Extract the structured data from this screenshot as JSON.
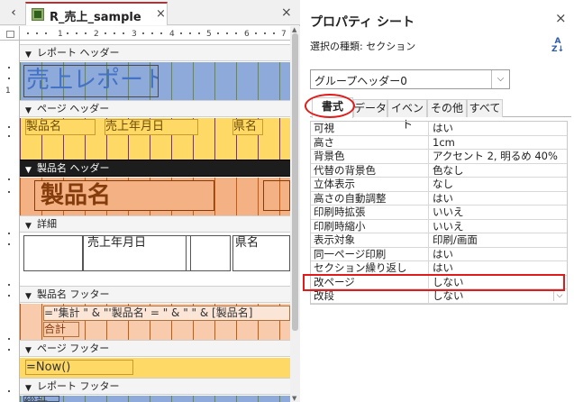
{
  "document_tab": {
    "title": "R_売上_sample",
    "close": "×"
  },
  "nav_prev": "‹",
  "window_close": "×",
  "ruler": {
    "marks": [
      "1",
      "2",
      "3",
      "4",
      "5",
      "6",
      "7"
    ],
    "vmarks": [
      "1"
    ]
  },
  "sections": {
    "report_header": "レポート ヘッダー",
    "page_header": "ページ ヘッダー",
    "group_header": "製品名 ヘッダー",
    "detail": "詳細",
    "group_footer": "製品名 フッター",
    "page_footer": "ページ フッター",
    "report_footer": "レポート フッター"
  },
  "controls": {
    "report_title": "売上レポート",
    "col_product": "製品名",
    "col_date": "売上年月日",
    "col_pref": "県名",
    "group_product": "製品名",
    "detail_date": "売上年月日",
    "detail_pref": "県名",
    "footer_expr": "=\"集計 \" & \"'製品名' = \" & \" \" & [製品名]",
    "footer_total": "合計",
    "page_now": "=Now()",
    "report_total": "総計"
  },
  "property_sheet": {
    "title": "プロパティ シート",
    "close": "×",
    "selection_label": "選択の種類: セクション",
    "sort_icon_top": "A",
    "sort_icon_bottom": "Z↓",
    "combo_value": "グループヘッダー0",
    "combo_arrow": "⌵",
    "tabs": [
      "書式",
      "データ",
      "イベント",
      "その他",
      "すべて"
    ],
    "active_tab": "書式",
    "rows": [
      {
        "k": "可視",
        "v": "はい"
      },
      {
        "k": "高さ",
        "v": "1cm"
      },
      {
        "k": "背景色",
        "v": "アクセント 2, 明るめ 40%"
      },
      {
        "k": "代替の背景色",
        "v": "色なし"
      },
      {
        "k": "立体表示",
        "v": "なし"
      },
      {
        "k": "高さの自動調整",
        "v": "はい"
      },
      {
        "k": "印刷時拡張",
        "v": "いいえ"
      },
      {
        "k": "印刷時縮小",
        "v": "いいえ"
      },
      {
        "k": "表示対象",
        "v": "印刷/画面"
      },
      {
        "k": "同一ページ印刷",
        "v": "はい"
      },
      {
        "k": "セクション繰り返し",
        "v": "はい"
      },
      {
        "k": "改ページ",
        "v": "しない"
      },
      {
        "k": "改段",
        "v": "しない"
      }
    ],
    "highlighted_row": "セクション繰り返し"
  },
  "colors": {
    "accent_red": "#e01b1b",
    "header_blue": "#8eaadb",
    "page_yellow": "#ffd966",
    "group_orange": "#f4b183",
    "footer_pink": "#f8cbad"
  }
}
